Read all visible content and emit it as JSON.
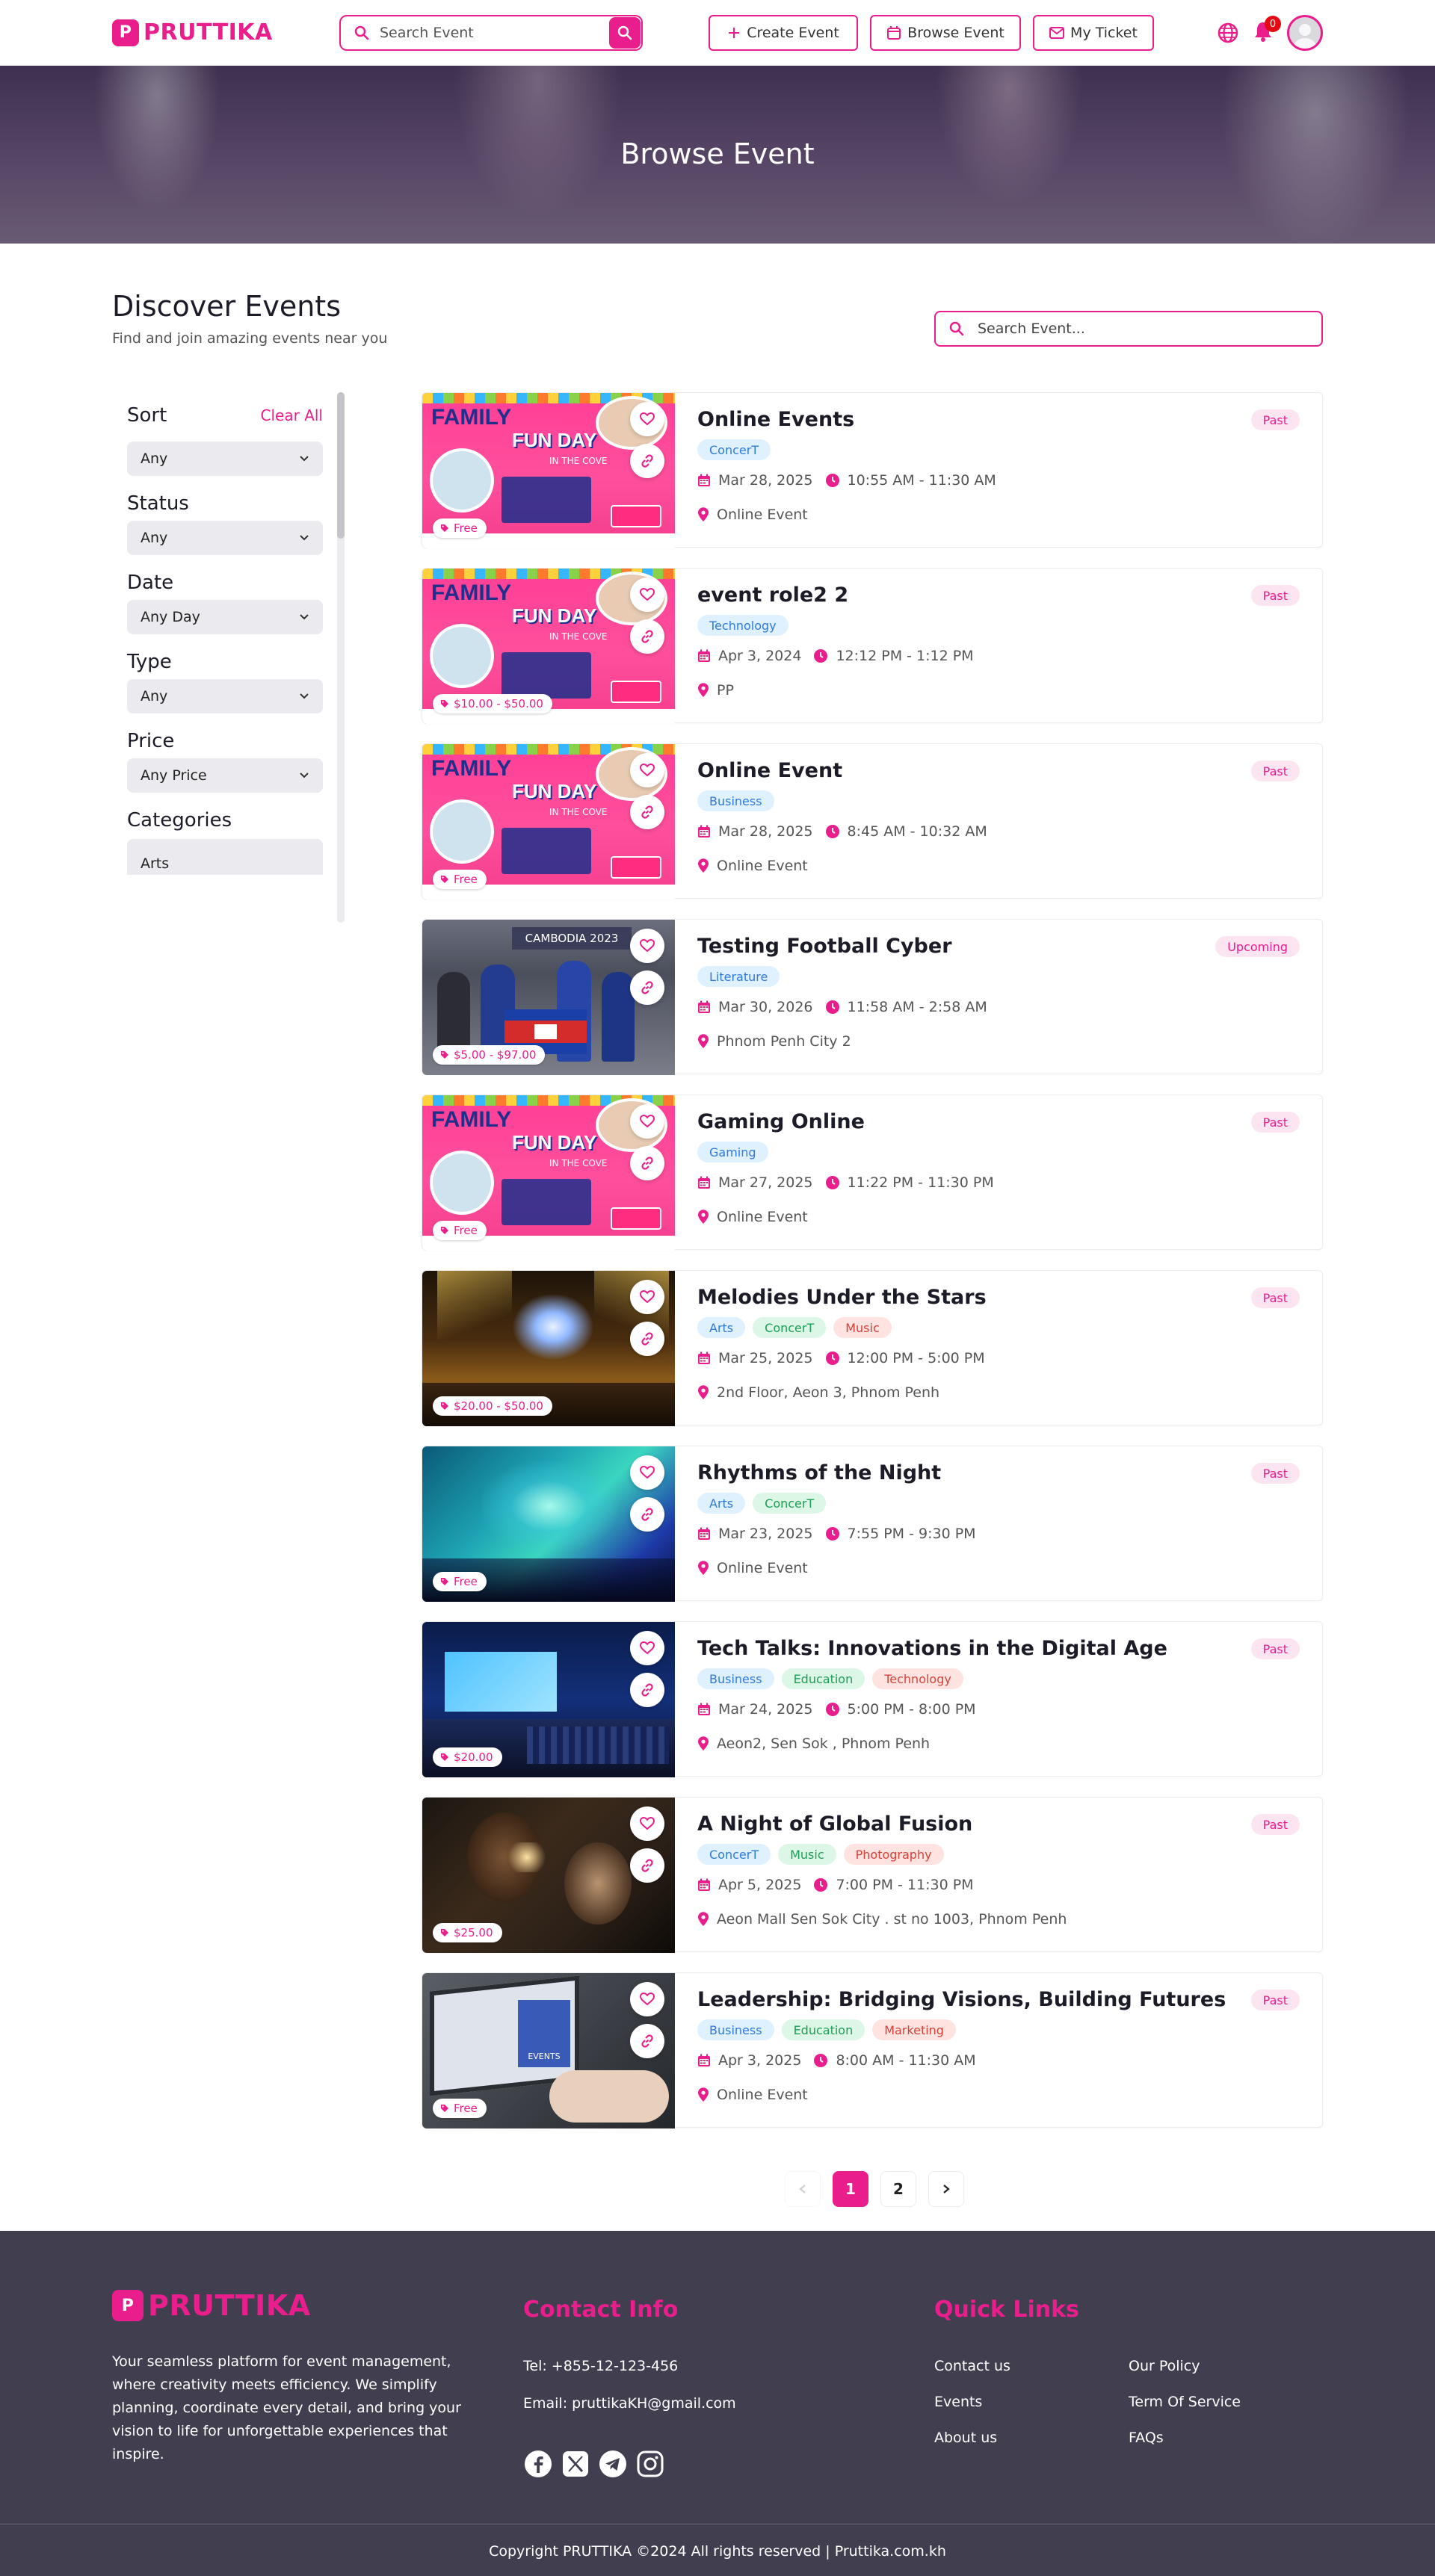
{
  "nav": {
    "brand": "PRUTTIKA",
    "search_placeholder": "Search Event",
    "create_event": "Create Event",
    "browse_event": "Browse Event",
    "my_ticket": "My Ticket",
    "notification_count": "0"
  },
  "hero": {
    "title": "Browse Event"
  },
  "discover": {
    "title": "Discover Events",
    "subtitle": "Find and join amazing events near you",
    "search_placeholder": "Search Event..."
  },
  "filters": {
    "sort_label": "Sort",
    "clear_all": "Clear All",
    "sort_value": "Any",
    "status_label": "Status",
    "status_value": "Any",
    "date_label": "Date",
    "date_value": "Any Day",
    "type_label": "Type",
    "type_value": "Any",
    "price_label": "Price",
    "price_value": "Any Price",
    "categories_label": "Categories",
    "categories": [
      "Arts"
    ]
  },
  "events": [
    {
      "title": "Online Events",
      "status": "Past",
      "tags": [
        {
          "label": "ConcerT",
          "color": "blue"
        }
      ],
      "date": "Mar 28, 2025",
      "time": "10:55 AM - 11:30 AM",
      "location": "Online Event",
      "price": "Free",
      "image": "family-fun-day"
    },
    {
      "title": "event role2 2",
      "status": "Past",
      "tags": [
        {
          "label": "Technology",
          "color": "blue"
        }
      ],
      "date": "Apr 3, 2024",
      "time": "12:12 PM - 1:12 PM",
      "location": "PP",
      "price": "$10.00 - $50.00",
      "image": "family-fun-day"
    },
    {
      "title": "Online Event",
      "status": "Past",
      "tags": [
        {
          "label": "Business",
          "color": "blue"
        }
      ],
      "date": "Mar 28, 2025",
      "time": "8:45 AM - 10:32 AM",
      "location": "Online Event",
      "price": "Free",
      "image": "family-fun-day"
    },
    {
      "title": "Testing Football Cyber",
      "status": "Upcoming",
      "tags": [
        {
          "label": "Literature",
          "color": "blue"
        }
      ],
      "date": "Mar 30, 2026",
      "time": "11:58 AM - 2:58 AM",
      "location": "Phnom Penh City 2",
      "price": "$5.00 - $97.00",
      "image": "cambodia-2023"
    },
    {
      "title": "Gaming Online",
      "status": "Past",
      "tags": [
        {
          "label": "Gaming",
          "color": "blue"
        }
      ],
      "date": "Mar 27, 2025",
      "time": "11:22 PM - 11:30 PM",
      "location": "Online Event",
      "price": "Free",
      "image": "family-fun-day"
    },
    {
      "title": "Melodies Under the Stars",
      "status": "Past",
      "tags": [
        {
          "label": "Arts",
          "color": "blue"
        },
        {
          "label": "ConcerT",
          "color": "green"
        },
        {
          "label": "Music",
          "color": "red"
        }
      ],
      "date": "Mar 25, 2025",
      "time": "12:00 PM - 5:00 PM",
      "location": "2nd Floor, Aeon 3, Phnom Penh",
      "price": "$20.00 - $50.00",
      "image": "concert-stage"
    },
    {
      "title": "Rhythms of the Night",
      "status": "Past",
      "tags": [
        {
          "label": "Arts",
          "color": "blue"
        },
        {
          "label": "ConcerT",
          "color": "green"
        }
      ],
      "date": "Mar 23, 2025",
      "time": "7:55 PM - 9:30 PM",
      "location": "Online Event",
      "price": "Free",
      "image": "concert-lights"
    },
    {
      "title": "Tech Talks: Innovations in the Digital Age",
      "status": "Past",
      "tags": [
        {
          "label": "Business",
          "color": "blue"
        },
        {
          "label": "Education",
          "color": "green"
        },
        {
          "label": "Technology",
          "color": "red"
        }
      ],
      "date": "Mar 24, 2025",
      "time": "5:00 PM - 8:00 PM",
      "location": "Aeon2, Sen Sok , Phnom Penh",
      "price": "$20.00",
      "image": "conference"
    },
    {
      "title": "A Night of Global Fusion",
      "status": "Past",
      "tags": [
        {
          "label": "ConcerT",
          "color": "blue"
        },
        {
          "label": "Music",
          "color": "green"
        },
        {
          "label": "Photography",
          "color": "red"
        }
      ],
      "date": "Apr 5, 2025",
      "time": "7:00 PM - 11:30 PM",
      "location": "Aeon Mall Sen Sok City . st no 1003, Phnom Penh",
      "price": "$25.00",
      "image": "musicians"
    },
    {
      "title": "Leadership: Bridging Visions, Building Futures",
      "status": "Past",
      "tags": [
        {
          "label": "Business",
          "color": "blue"
        },
        {
          "label": "Education",
          "color": "green"
        },
        {
          "label": "Marketing",
          "color": "red"
        }
      ],
      "date": "Apr 3, 2025",
      "time": "8:00 AM - 11:30 AM",
      "location": "Online Event",
      "price": "Free",
      "image": "laptop-events"
    }
  ],
  "pagination": {
    "pages": [
      "1",
      "2"
    ],
    "current": "1"
  },
  "footer": {
    "brand": "PRUTTIKA",
    "about": "Your seamless platform for event management, where creativity meets efficiency. We simplify planning, coordinate every detail, and bring your vision to life for unforgettable experiences that inspire.",
    "contact_title": "Contact Info",
    "tel": "Tel: +855-12-123-456",
    "email": "Email: pruttikaKH@gmail.com",
    "links_title": "Quick Links",
    "links": [
      "Contact us",
      "Events",
      "About us",
      "Our Policy",
      "Term Of Service",
      "FAQs"
    ],
    "copyright": "Copyright PRUTTIKA ©2024 All rights reserved | Pruttika.com.kh"
  },
  "colors": {
    "accent": "#e91e8c",
    "footer_bg": "#413e50",
    "tag_blue": "#2e7ad8",
    "tag_green": "#1c9e55",
    "tag_red": "#d4423a"
  }
}
